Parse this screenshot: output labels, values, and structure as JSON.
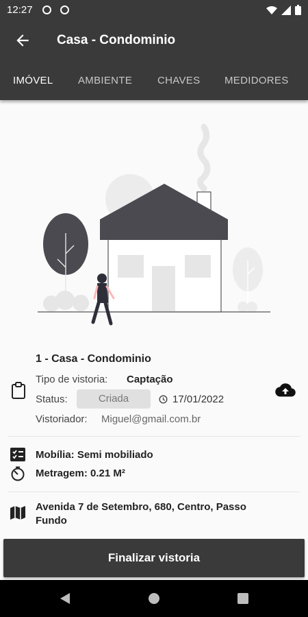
{
  "status_bar": {
    "time": "12:27"
  },
  "app_bar": {
    "title": "Casa - Condominio"
  },
  "tabs": [
    {
      "label": "IMÓVEL",
      "active": true
    },
    {
      "label": "AMBIENTE",
      "active": false
    },
    {
      "label": "CHAVES",
      "active": false
    },
    {
      "label": "MEDIDORES",
      "active": false
    }
  ],
  "property": {
    "title": "1 - Casa - Condominio",
    "inspection_type_label": "Tipo de vistoria:",
    "inspection_type_value": "Captação",
    "status_label": "Status:",
    "status_value": "Criada",
    "date": "17/01/2022",
    "inspector_label": "Vistoriador:",
    "inspector_value": "Miguel@gmail.com.br"
  },
  "details": {
    "furniture": "Mobília: Semi mobiliado",
    "size": "Metragem: 0.21 M²"
  },
  "address": {
    "line1": "Avenida 7 de Setembro, 680, Centro, Passo",
    "line2": "Fundo"
  },
  "actions": {
    "finish_label": "Finalizar vistoria"
  },
  "colors": {
    "primary": "#3a3a3a",
    "chip": "#e0e0e0"
  }
}
